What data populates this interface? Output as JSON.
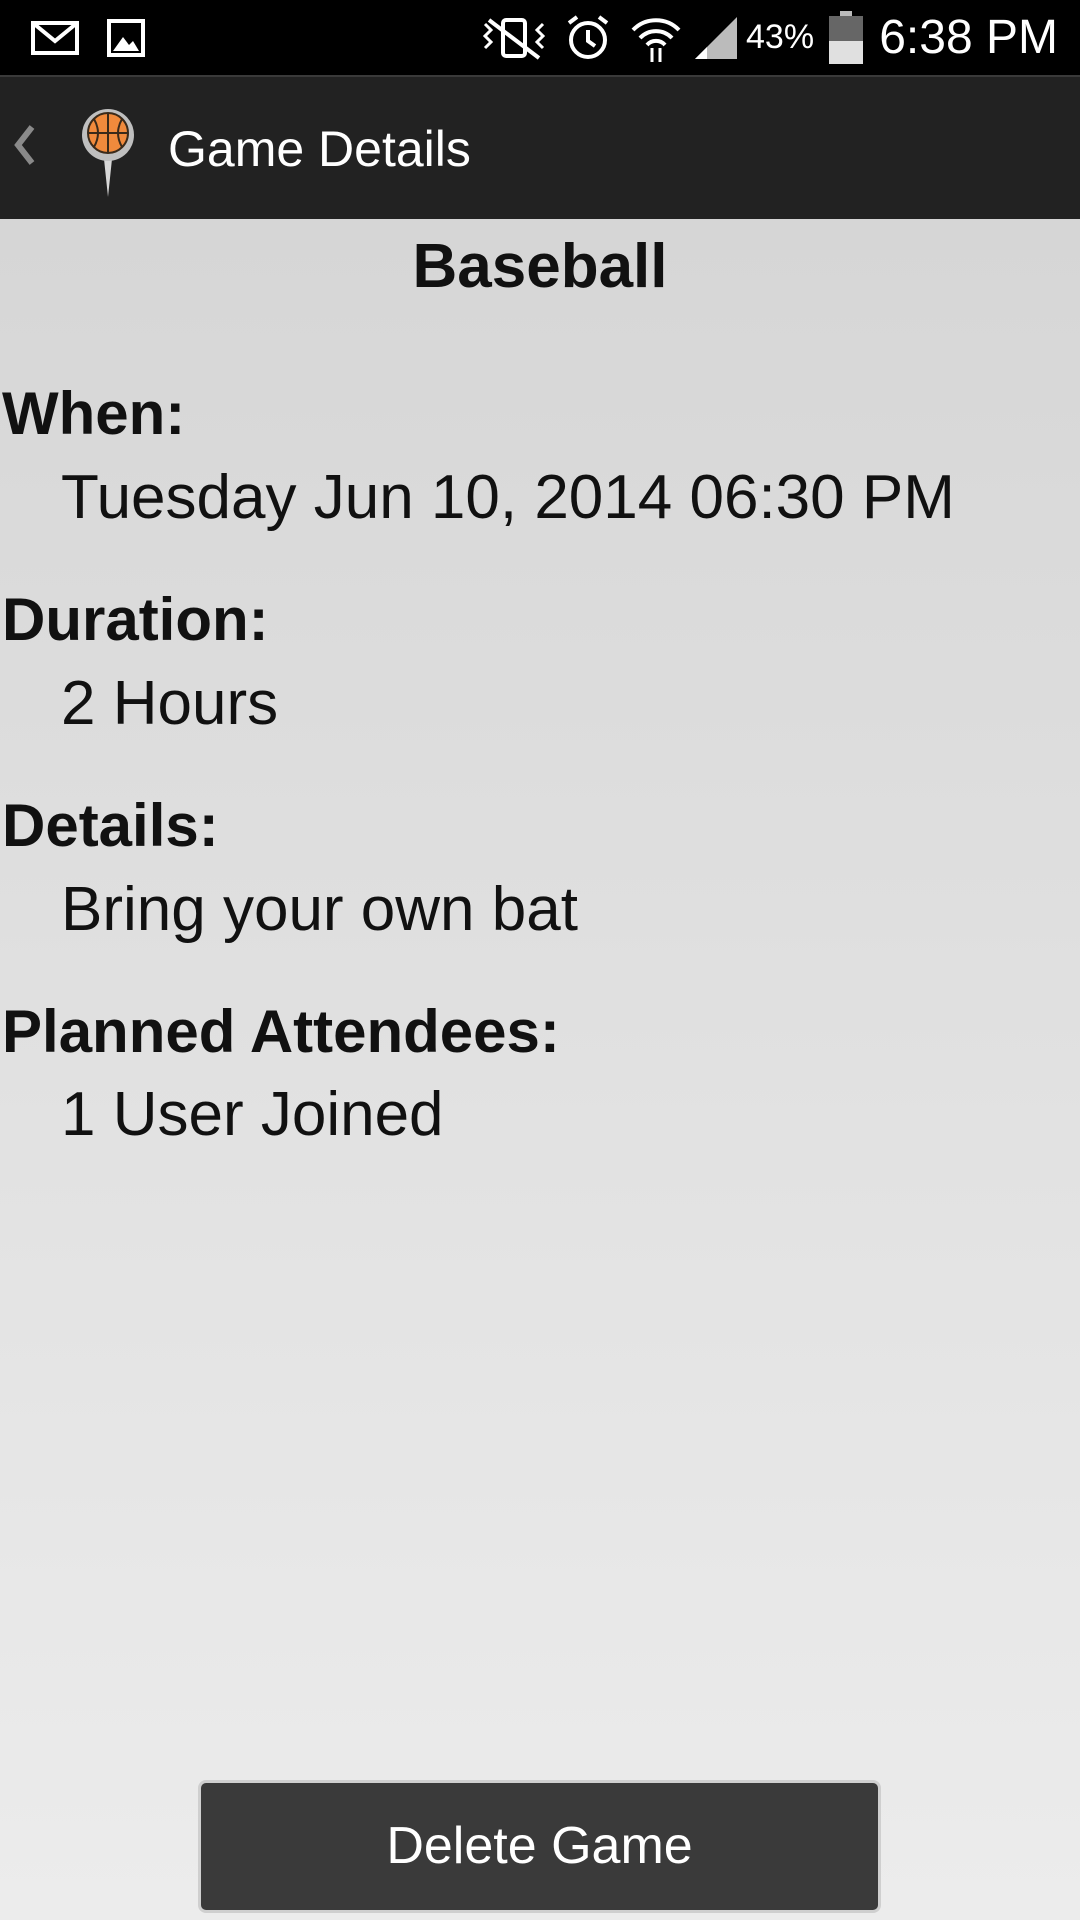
{
  "status_bar": {
    "icons": [
      "mail-icon",
      "image-icon",
      "vibrate-icon",
      "alarm-icon",
      "wifi-icon",
      "signal-icon",
      "battery-icon"
    ],
    "battery_percent": "43%",
    "time": "6:38 PM"
  },
  "action_bar": {
    "title": "Game Details",
    "app_icon": "basketball-pin-icon",
    "up_icon": "up-caret-icon"
  },
  "game": {
    "title": "Baseball",
    "when_label": "When:",
    "when_value": "Tuesday Jun 10, 2014 06:30 PM",
    "duration_label": "Duration:",
    "duration_value": "2 Hours",
    "details_label": "Details:",
    "details_value": "Bring your own bat",
    "attendees_label": "Planned Attendees:",
    "attendees_value": "1 User Joined"
  },
  "actions": {
    "delete_label": "Delete Game"
  },
  "colors": {
    "status_bar_bg": "#000000",
    "action_bar_bg": "#222222",
    "content_bg": "#e3e3e3",
    "button_bg": "#3a3a3a",
    "basketball": "#f08a3c"
  }
}
